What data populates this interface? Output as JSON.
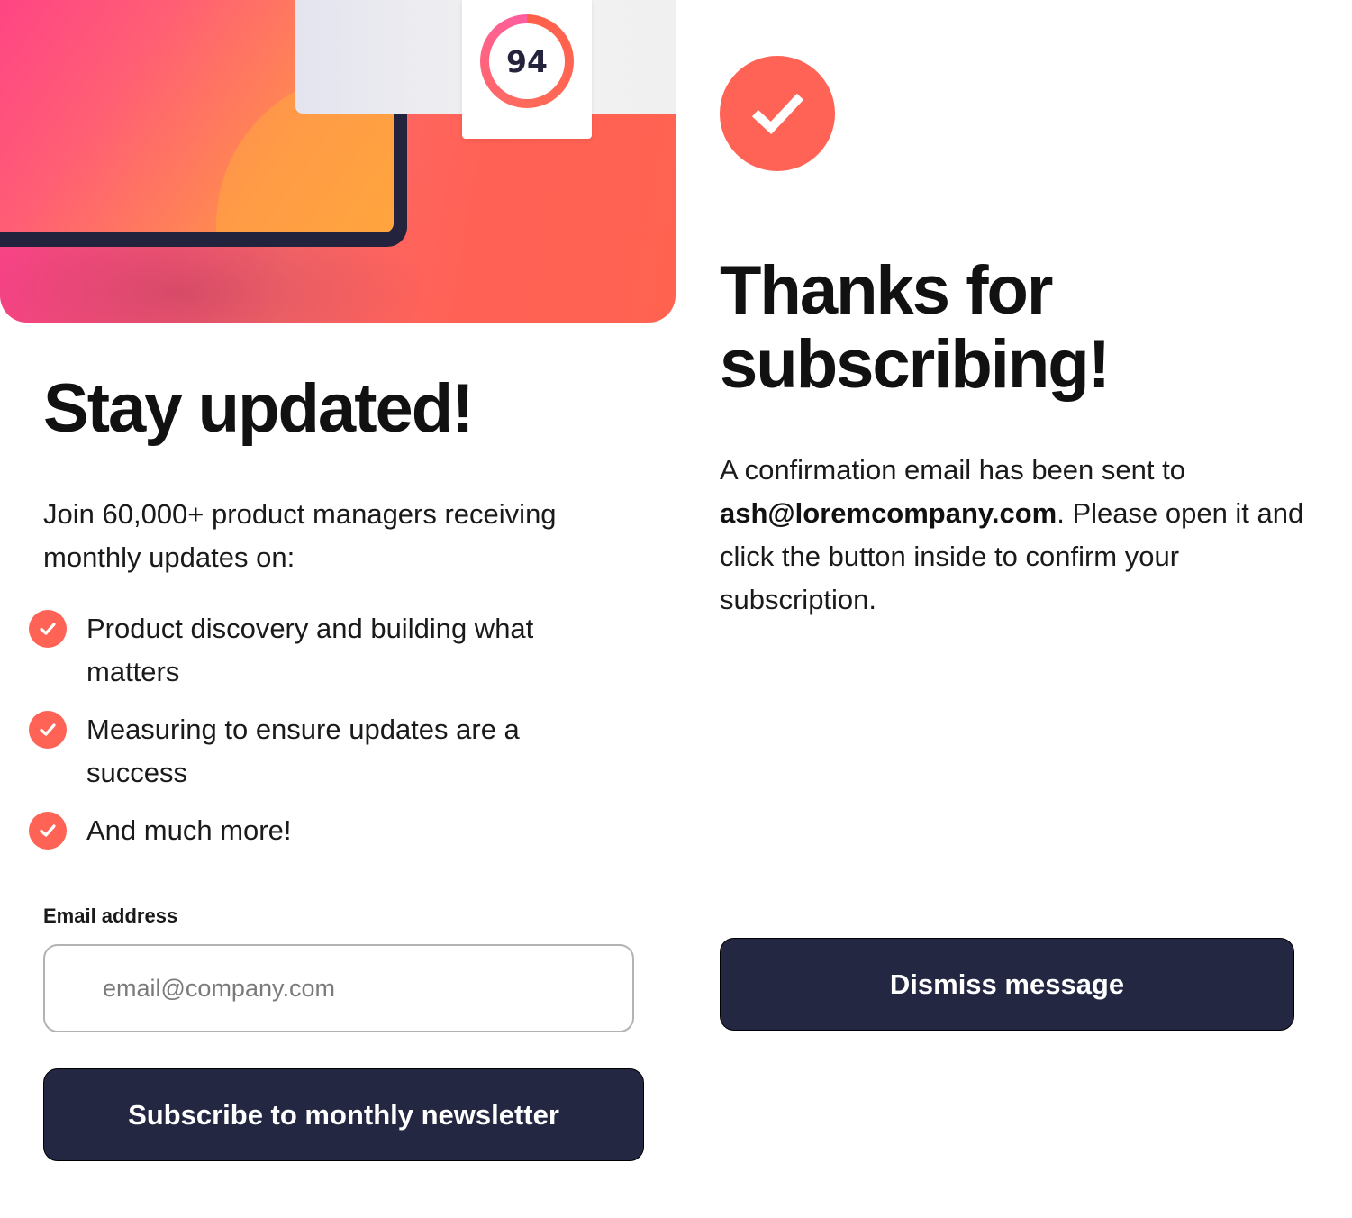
{
  "hero": {
    "score": "94"
  },
  "signup": {
    "title": "Stay updated!",
    "intro": "Join 60,000+ product managers receiving monthly updates on:",
    "benefits": [
      "Product discovery and building what matters",
      "Measuring to ensure updates are a success",
      "And much more!"
    ],
    "email_label": "Email address",
    "email_placeholder": "email@company.com",
    "email_value": "",
    "subscribe_label": "Subscribe to monthly newsletter"
  },
  "success": {
    "title": "Thanks for subscribing!",
    "message_prefix": "A confirmation email has been sent to",
    "email": "ash@loremcompany.com",
    "message_suffix": ". Please open it and click the button inside to confirm your subscription.",
    "dismiss_label": "Dismiss message"
  },
  "icons": {
    "benefit_check": "check-circle-icon",
    "success": "check-circle-icon"
  },
  "colors": {
    "accent": "#ff6356",
    "button_bg": "#242742",
    "button_text": "#ffffff",
    "text": "#111111",
    "input_border": "#b3b3b3"
  }
}
